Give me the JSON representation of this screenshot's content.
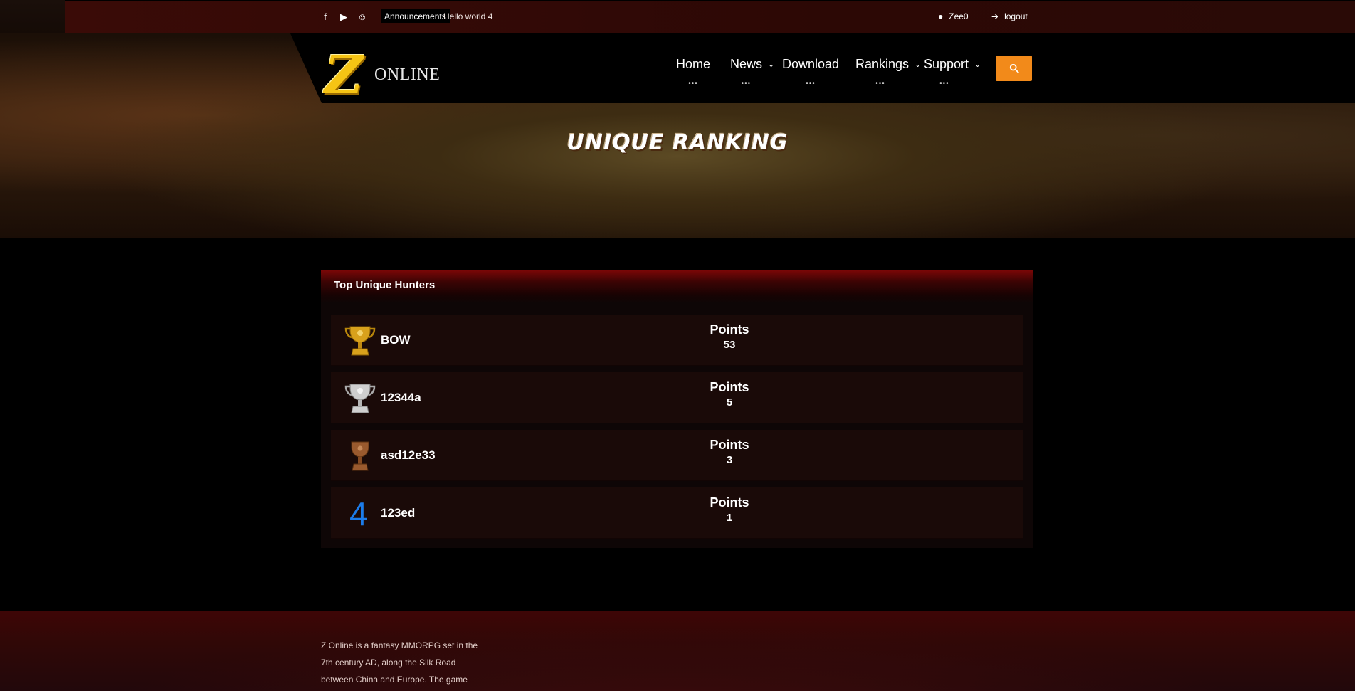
{
  "topbar": {
    "social": [
      {
        "icon": "facebook-icon",
        "glyph": "f"
      },
      {
        "icon": "youtube-icon",
        "glyph": "▶"
      },
      {
        "icon": "discord-icon",
        "glyph": "☺"
      }
    ],
    "announcement_label": "Announcements",
    "announcement_text": "Hello world 4",
    "username": "Zee0",
    "logout_label": "logout"
  },
  "header": {
    "logo_letter": "Z",
    "logo_text": "ONLINE",
    "nav": [
      {
        "label": "Home",
        "has_dropdown": false
      },
      {
        "label": "News",
        "has_dropdown": true
      },
      {
        "label": "Download",
        "has_dropdown": false
      },
      {
        "label": "Rankings",
        "has_dropdown": true
      },
      {
        "label": "Support",
        "has_dropdown": true
      }
    ],
    "nav_dots": "•••",
    "chevron": "⌄"
  },
  "hero": {
    "title": "UNIQUE RANKING"
  },
  "ranking": {
    "panel_title": "Top Unique Hunters",
    "points_label": "Points",
    "rows": [
      {
        "rank": 1,
        "medal": "gold",
        "name": "BOW",
        "points": "53"
      },
      {
        "rank": 2,
        "medal": "silver",
        "name": "12344a",
        "points": "5"
      },
      {
        "rank": 3,
        "medal": "bronze",
        "name": "asd12e33",
        "points": "3"
      },
      {
        "rank": 4,
        "medal": "none",
        "rank_text": "4",
        "name": "123ed",
        "points": "1"
      }
    ]
  },
  "footer": {
    "about_text": "Z Online is a fantasy MMORPG set in the 7th century AD, along the Silk Road between China and Europe. The game requires no"
  },
  "colors": {
    "accent": "#f28a1a",
    "topbar": "#3a0b07",
    "panel_head": "#7a0707",
    "rank_number": "#1c7cea",
    "gold": "#d8a11c",
    "silver": "#c9c9c9",
    "bronze": "#9a5a2e"
  }
}
